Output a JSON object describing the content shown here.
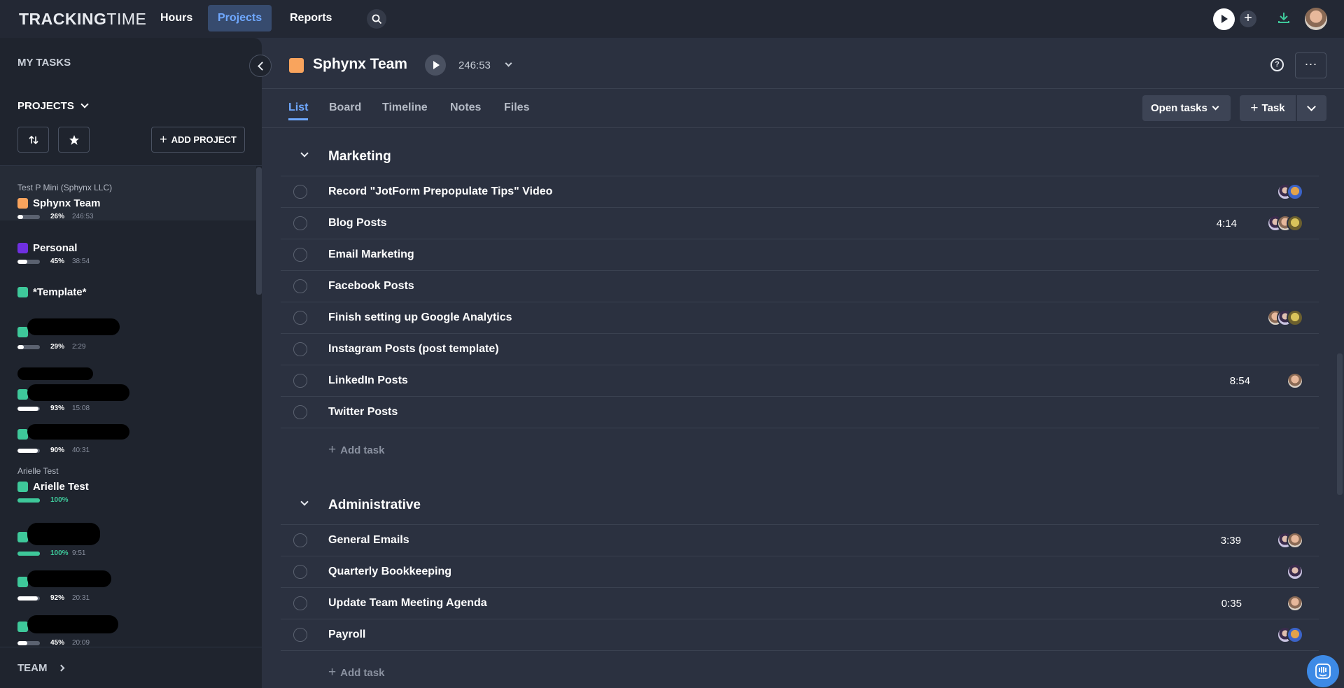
{
  "app": {
    "logo_bold": "TRACKING",
    "logo_light": "TIME"
  },
  "nav": {
    "hours": "Hours",
    "projects": "Projects",
    "reports": "Reports"
  },
  "sidebar": {
    "my_tasks": "MY TASKS",
    "projects": "PROJECTS",
    "add_project": "ADD PROJECT",
    "team": "TEAM",
    "items": [
      {
        "client": "Test P Mini (Sphynx LLC)",
        "name": "Sphynx Team",
        "color": "#f9a45d",
        "progress": 0.26,
        "pct": "26%",
        "time": "246:53"
      },
      {
        "client": "",
        "name": "Personal",
        "color": "#6f2fe0",
        "progress": 0.45,
        "pct": "45%",
        "time": "38:54"
      },
      {
        "client": "",
        "name": "*Template*",
        "color": "#3ec89a"
      },
      {
        "client": "",
        "name": "",
        "color": "#3ec89a",
        "progress": 0.29,
        "pct": "29%",
        "time": "2:29"
      },
      {
        "client": "",
        "name": "",
        "color": "#3ec89a",
        "progress": 0.93,
        "pct": "93%",
        "time": "15:08"
      },
      {
        "client": "",
        "name": "",
        "color": "#3ec89a",
        "progress": 0.9,
        "pct": "90%",
        "time": "40:31"
      },
      {
        "client": "Arielle Test",
        "name": "Arielle Test",
        "color": "#3ec89a",
        "progress": 1.0,
        "pct": "100%",
        "time": ""
      },
      {
        "client": "",
        "name": "",
        "color": "#3ec89a",
        "progress": 1.0,
        "pct": "100%",
        "time": "9:51"
      },
      {
        "client": "",
        "name": "",
        "color": "#3ec89a",
        "progress": 0.92,
        "pct": "92%",
        "time": "20:31"
      },
      {
        "client": "",
        "name": "",
        "color": "#3ec89a",
        "progress": 0.45,
        "pct": "45%",
        "time": "20:09"
      }
    ]
  },
  "project": {
    "title": "Sphynx Team",
    "time": "246:53",
    "color": "#f9a45d"
  },
  "tabs": {
    "list": "List",
    "board": "Board",
    "timeline": "Timeline",
    "notes": "Notes",
    "files": "Files"
  },
  "toolbar": {
    "open_tasks": "Open tasks",
    "add_task": "Task"
  },
  "sections": [
    {
      "title": "Marketing",
      "add_task": "Add task",
      "tasks": [
        {
          "name": "Record \"JotForm Prepopulate Tips\" Video",
          "duration": "",
          "avatars": [
            "a1",
            "a2"
          ]
        },
        {
          "name": "Blog Posts",
          "duration": "4:14",
          "avatars": [
            "a1",
            "a3",
            "a4"
          ]
        },
        {
          "name": "Email Marketing",
          "duration": "",
          "avatars": []
        },
        {
          "name": "Facebook Posts",
          "duration": "",
          "avatars": []
        },
        {
          "name": "Finish setting up Google Analytics",
          "duration": "",
          "avatars": [
            "a3",
            "a1",
            "a4"
          ]
        },
        {
          "name": "Instagram Posts (post template)",
          "duration": "",
          "avatars": []
        },
        {
          "name": "LinkedIn Posts",
          "duration": "8:54",
          "avatars": [
            "a3"
          ]
        },
        {
          "name": "Twitter Posts",
          "duration": "",
          "avatars": []
        }
      ]
    },
    {
      "title": "Administrative",
      "add_task": "Add task",
      "tasks": [
        {
          "name": "General Emails",
          "duration": "3:39",
          "avatars": [
            "a1",
            "a3"
          ]
        },
        {
          "name": "Quarterly Bookkeeping",
          "duration": "",
          "avatars": [
            "a1"
          ]
        },
        {
          "name": "Update Team Meeting Agenda",
          "duration": "0:35",
          "avatars": [
            "a3"
          ]
        },
        {
          "name": "Payroll",
          "duration": "",
          "avatars": [
            "a1",
            "a2"
          ]
        }
      ]
    }
  ]
}
